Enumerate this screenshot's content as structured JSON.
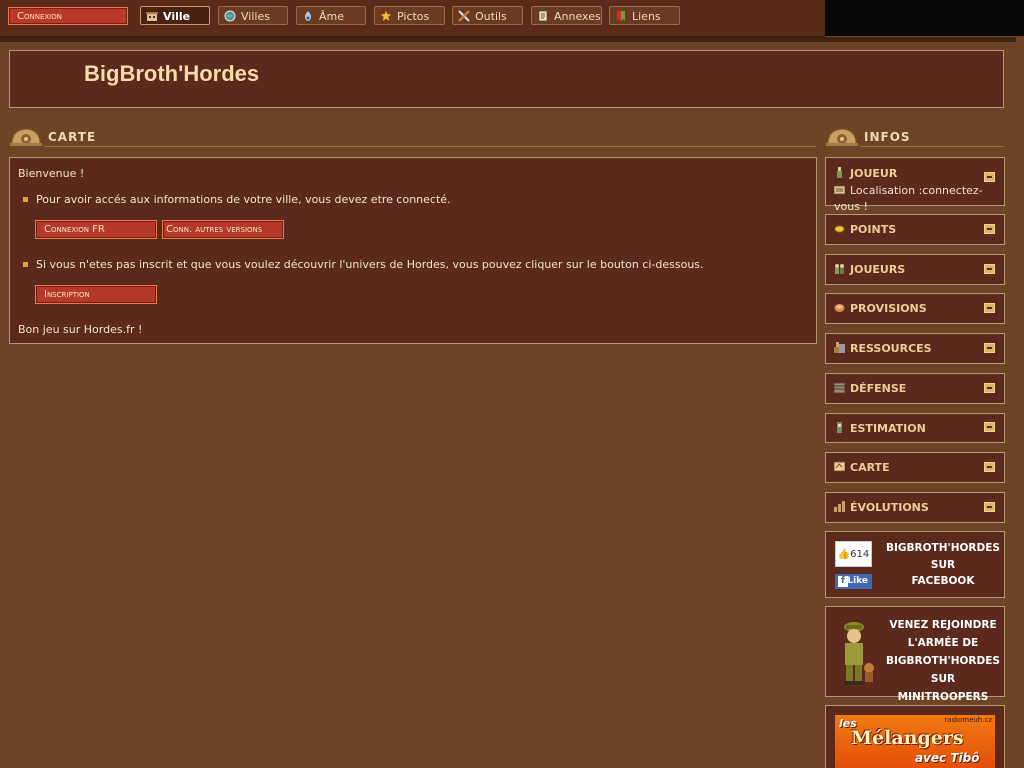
{
  "nav": {
    "connexion": "Connexion",
    "tabs": [
      {
        "label": "Ville",
        "icon": "town-icon",
        "active": true
      },
      {
        "label": "Villes",
        "icon": "globe-icon"
      },
      {
        "label": "Âme",
        "icon": "soul-icon"
      },
      {
        "label": "Pictos",
        "icon": "star-icon"
      },
      {
        "label": "Outils",
        "icon": "tools-icon"
      },
      {
        "label": "Annexes",
        "icon": "document-icon"
      },
      {
        "label": "Liens",
        "icon": "bookmark-icon"
      }
    ]
  },
  "header": {
    "title": "BigBroth'Hordes"
  },
  "main": {
    "section_title": "CARTE",
    "welcome": "Bienvenue !",
    "info_connect": "Pour avoir accés aux informations de votre ville, vous devez etre connecté.",
    "btn_connexion_fr": "Connexion FR",
    "btn_other_versions": "Conn. autres versions",
    "info_register": "Si vous n'etes pas inscrit et que vous voulez découvrir l'univers de Hordes, vous pouvez cliquer sur le bouton ci-dessous.",
    "btn_inscription": "Inscription",
    "goodbye": "Bon jeu sur Hordes.fr !"
  },
  "sidebar": {
    "section_title": "INFOS",
    "player": {
      "label": "JOUEUR",
      "location": "Localisation :connectez-vous !"
    },
    "items": [
      {
        "label": "POINTS",
        "icon": "coin-icon"
      },
      {
        "label": "JOUEURS",
        "icon": "players-icon"
      },
      {
        "label": "PROVISIONS",
        "icon": "food-icon"
      },
      {
        "label": "RESSOURCES",
        "icon": "resources-icon"
      },
      {
        "label": "DÉFENSE",
        "icon": "defense-icon"
      },
      {
        "label": "ESTIMATION",
        "icon": "estimation-icon"
      },
      {
        "label": "CARTE",
        "icon": "map-icon"
      },
      {
        "label": "ÉVOLUTIONS",
        "icon": "evolution-icon"
      }
    ],
    "facebook": {
      "count": "614",
      "like": "Like",
      "text_line1": "BIGBROTH'HORDES",
      "text_line2": "SUR",
      "text_line3": "FACEBOOK"
    },
    "minitroopers": {
      "line1": "VENEZ REJOINDRE",
      "line2": "L'ARMÉE DE",
      "line3": "BIGBROTH'HORDES",
      "line4": "SUR MINITROOPERS"
    },
    "ad": {
      "title": "Mélangers",
      "top": "les",
      "bottom": "avec Tibô",
      "url": "radiomeuh.cz"
    }
  },
  "colors": {
    "background": "#6e4326",
    "panel": "#5c2a1d",
    "border": "#b89874",
    "accent_red": "#b5392a",
    "title": "#f8dba8",
    "label": "#f0cc98"
  }
}
